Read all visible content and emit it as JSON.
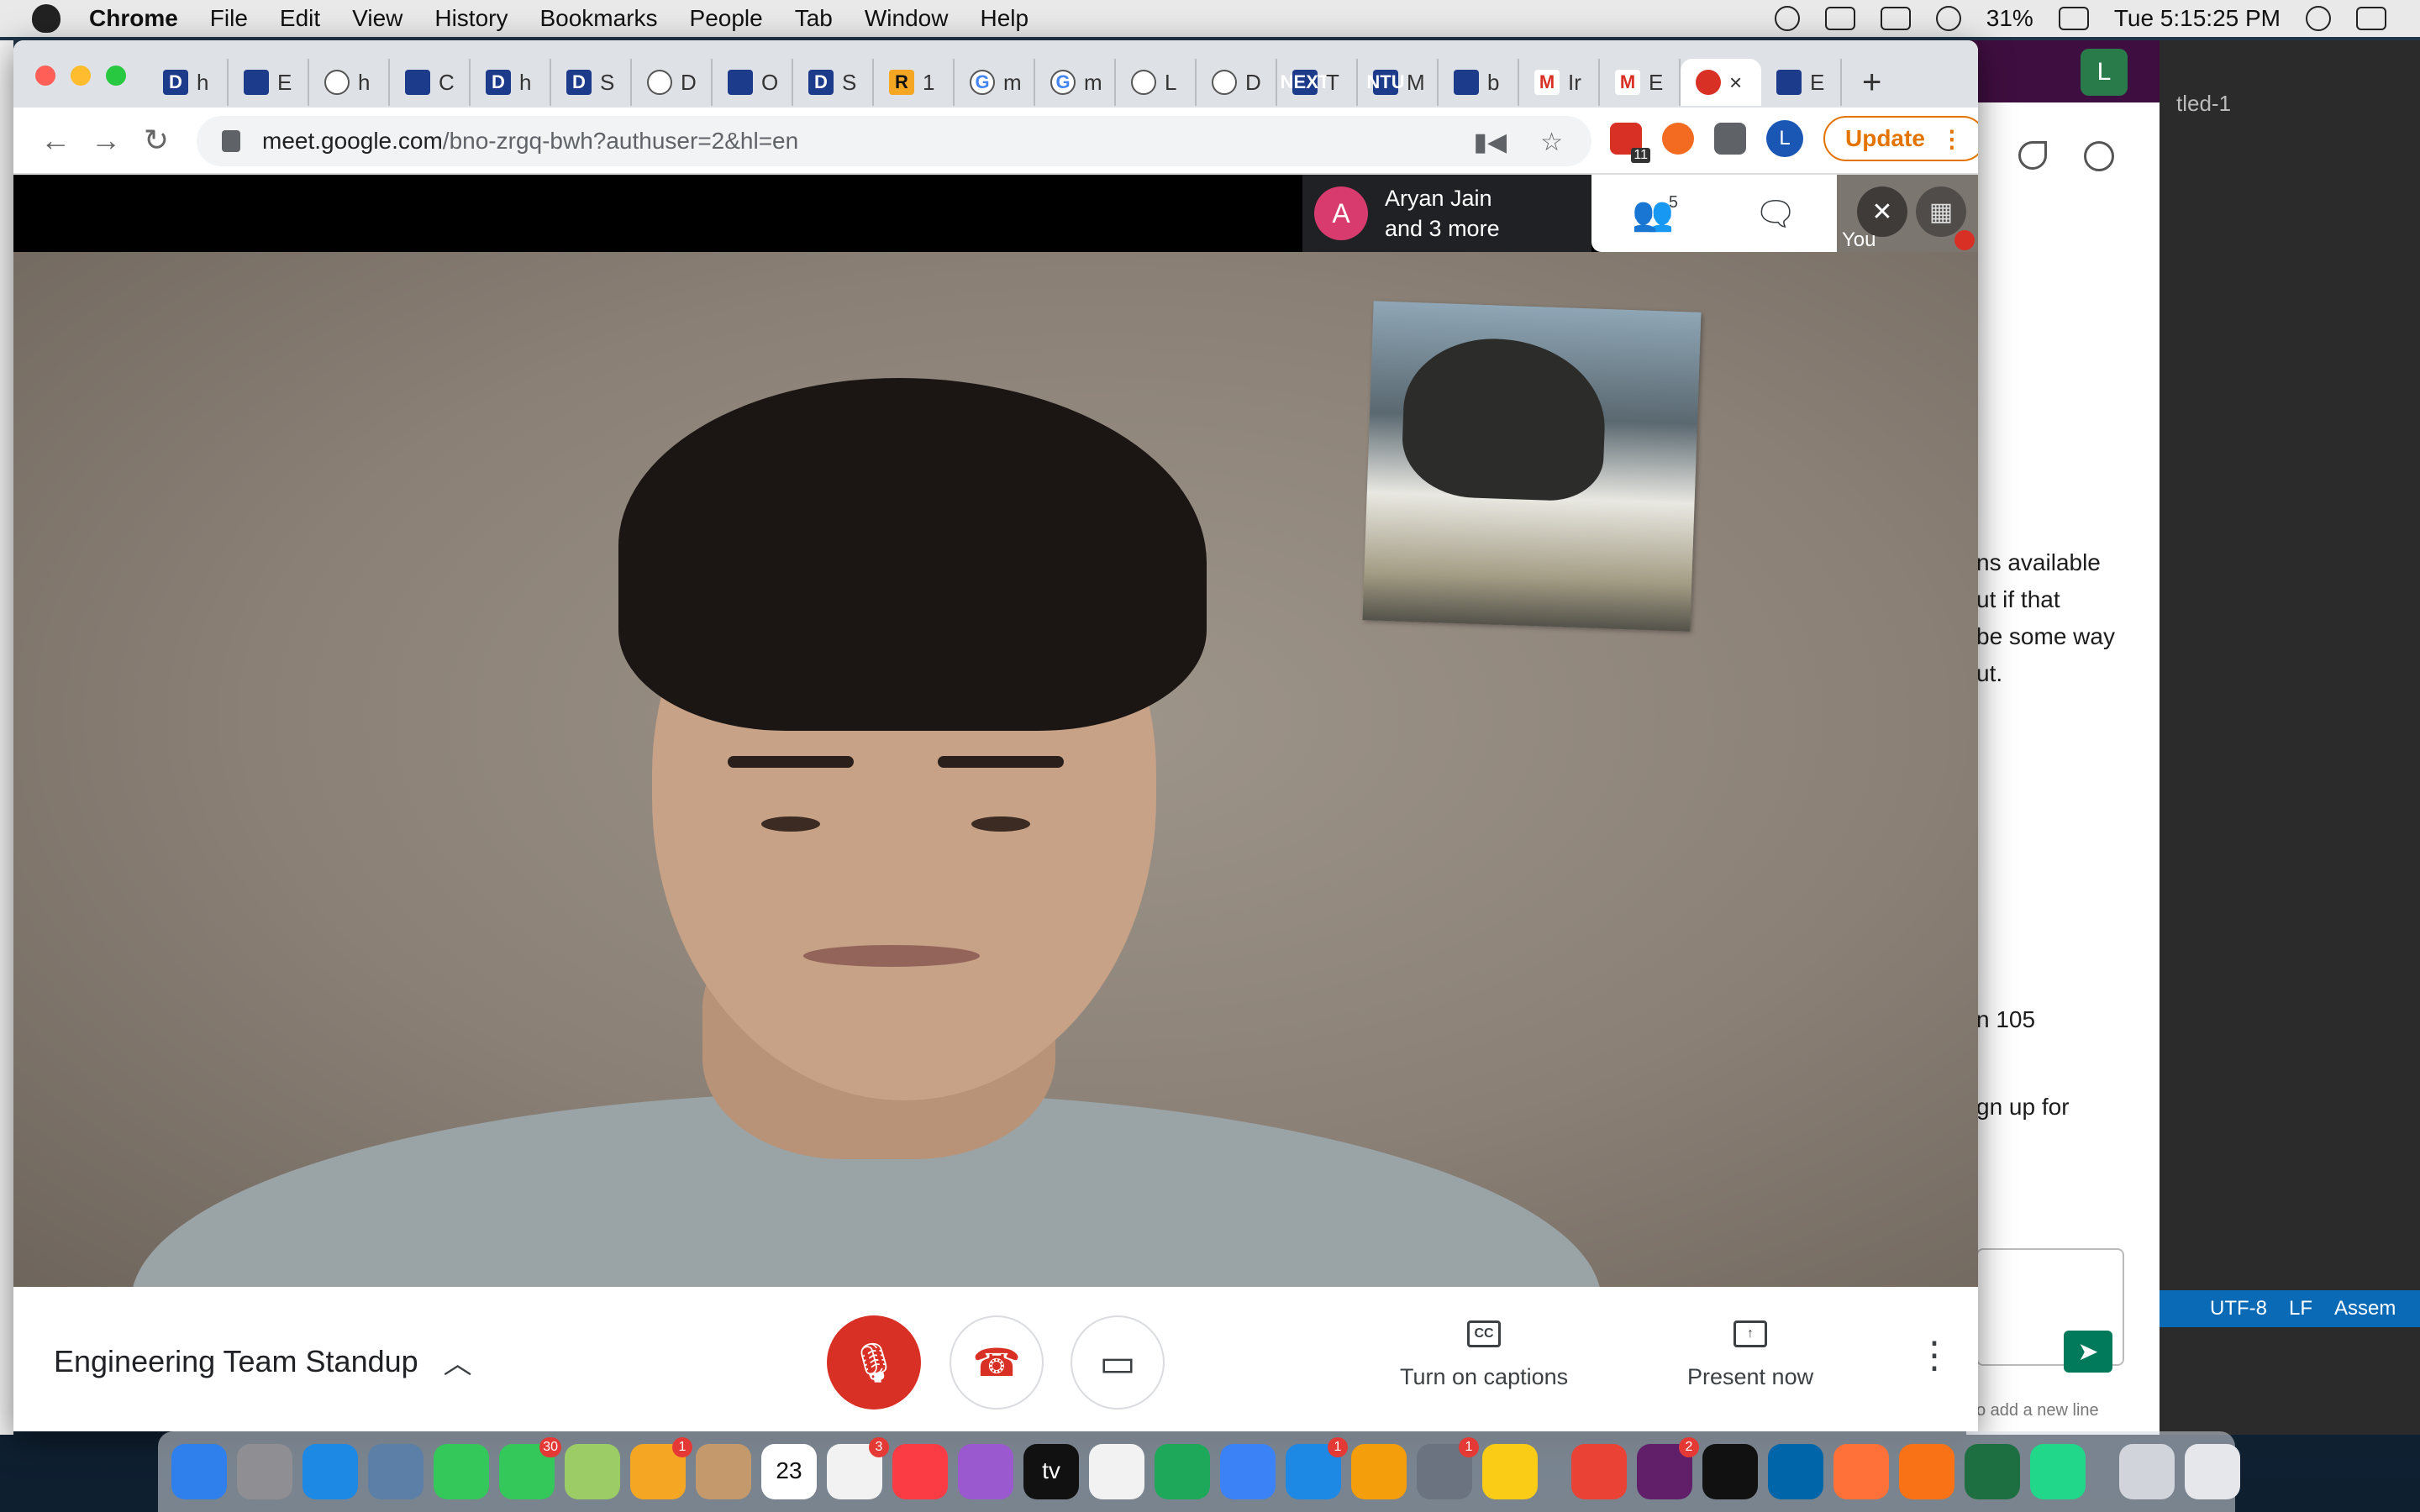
{
  "menubar": {
    "app": "Chrome",
    "items": [
      "File",
      "Edit",
      "View",
      "History",
      "Bookmarks",
      "People",
      "Tab",
      "Window",
      "Help"
    ],
    "battery": "31%",
    "clock": "Tue 5:15:25 PM"
  },
  "browser": {
    "tabs": [
      {
        "icon": "D",
        "label": "h"
      },
      {
        "icon": "chart-icon",
        "label": "E"
      },
      {
        "icon": "globe-icon",
        "label": "h"
      },
      {
        "icon": "gear-icon",
        "label": "C"
      },
      {
        "icon": "D",
        "label": "h"
      },
      {
        "icon": "D",
        "label": "S"
      },
      {
        "icon": "globe-icon",
        "label": "D"
      },
      {
        "icon": "docs-icon",
        "label": "O"
      },
      {
        "icon": "D",
        "label": "S"
      },
      {
        "icon": "R",
        "label": "1"
      },
      {
        "icon": "G",
        "label": "m"
      },
      {
        "icon": "G",
        "label": "m"
      },
      {
        "icon": "globe-icon",
        "label": "L"
      },
      {
        "icon": "globe-icon",
        "label": "D"
      },
      {
        "icon": "NEXT",
        "label": "T"
      },
      {
        "icon": "NTU",
        "label": "M"
      },
      {
        "icon": "stack-icon",
        "label": "b"
      },
      {
        "icon": "M",
        "label": "Ir"
      },
      {
        "icon": "M",
        "label": "E"
      },
      {
        "icon": "record-icon",
        "label": "×"
      },
      {
        "icon": "outlook-icon",
        "label": "E"
      }
    ],
    "url_host": "meet.google.com",
    "url_path": "/bno-zrgq-bwh?authuser=2&hl=en",
    "update_label": "Update",
    "profile_initial": "L",
    "ext_badge": "11"
  },
  "meet": {
    "presenter_initial": "A",
    "presenter_name": "Aryan Jain",
    "presenter_more": "and 3 more",
    "participant_count": "5",
    "self_label": "You",
    "meeting_title": "Engineering Team Standup",
    "captions_label": "Turn on captions",
    "captions_icon_text": "CC",
    "present_label": "Present now"
  },
  "background_apps": {
    "slack_profile_initial": "L",
    "slack_lines": [
      "ns available",
      "ut if that",
      "be some way",
      "ut.",
      "n 105",
      "gn up for",
      "o add a new line"
    ],
    "ide_title": "tled-1",
    "ide_status": [
      "UTF-8",
      "LF",
      "Assem"
    ]
  },
  "dock": {
    "apps": [
      {
        "name": "finder",
        "color": "#2f80ed"
      },
      {
        "name": "launchpad",
        "color": "#8e8e93"
      },
      {
        "name": "safari",
        "color": "#1e88e5"
      },
      {
        "name": "preview",
        "color": "#5b7fa6"
      },
      {
        "name": "facetime",
        "color": "#34c759"
      },
      {
        "name": "messages",
        "color": "#34c759",
        "badge": "30"
      },
      {
        "name": "maps",
        "color": "#9ccc65"
      },
      {
        "name": "photos",
        "color": "#f5a623",
        "badge": "1"
      },
      {
        "name": "contacts",
        "color": "#c49a6c"
      },
      {
        "name": "calendar",
        "color": "#ffffff",
        "text": "23"
      },
      {
        "name": "reminders",
        "color": "#f2f2f2",
        "badge": "3"
      },
      {
        "name": "music",
        "color": "#fc3c44"
      },
      {
        "name": "podcasts",
        "color": "#9b59d0"
      },
      {
        "name": "tv",
        "color": "#111111",
        "text": "tv"
      },
      {
        "name": "news",
        "color": "#f2f2f2"
      },
      {
        "name": "numbers",
        "color": "#1ea85a"
      },
      {
        "name": "keynote",
        "color": "#3b82f6"
      },
      {
        "name": "app-store",
        "color": "#1e88e5",
        "badge": "1"
      },
      {
        "name": "pages",
        "color": "#f59e0b"
      },
      {
        "name": "system-preferences",
        "color": "#6b7280",
        "badge": "1"
      },
      {
        "name": "notes",
        "color": "#facc15"
      },
      {
        "name": "chrome",
        "color": "#ea4335"
      },
      {
        "name": "slack",
        "color": "#611f69",
        "badge": "2"
      },
      {
        "name": "terminal",
        "color": "#111111"
      },
      {
        "name": "vscode",
        "color": "#0065a9"
      },
      {
        "name": "firefox",
        "color": "#ff7139"
      },
      {
        "name": "sketch-pen",
        "color": "#f97316"
      },
      {
        "name": "excel",
        "color": "#1d6f42"
      },
      {
        "name": "pycharm",
        "color": "#21d789"
      },
      {
        "name": "downloads",
        "color": "#d1d5db"
      },
      {
        "name": "trash",
        "color": "#e5e7eb"
      }
    ]
  }
}
